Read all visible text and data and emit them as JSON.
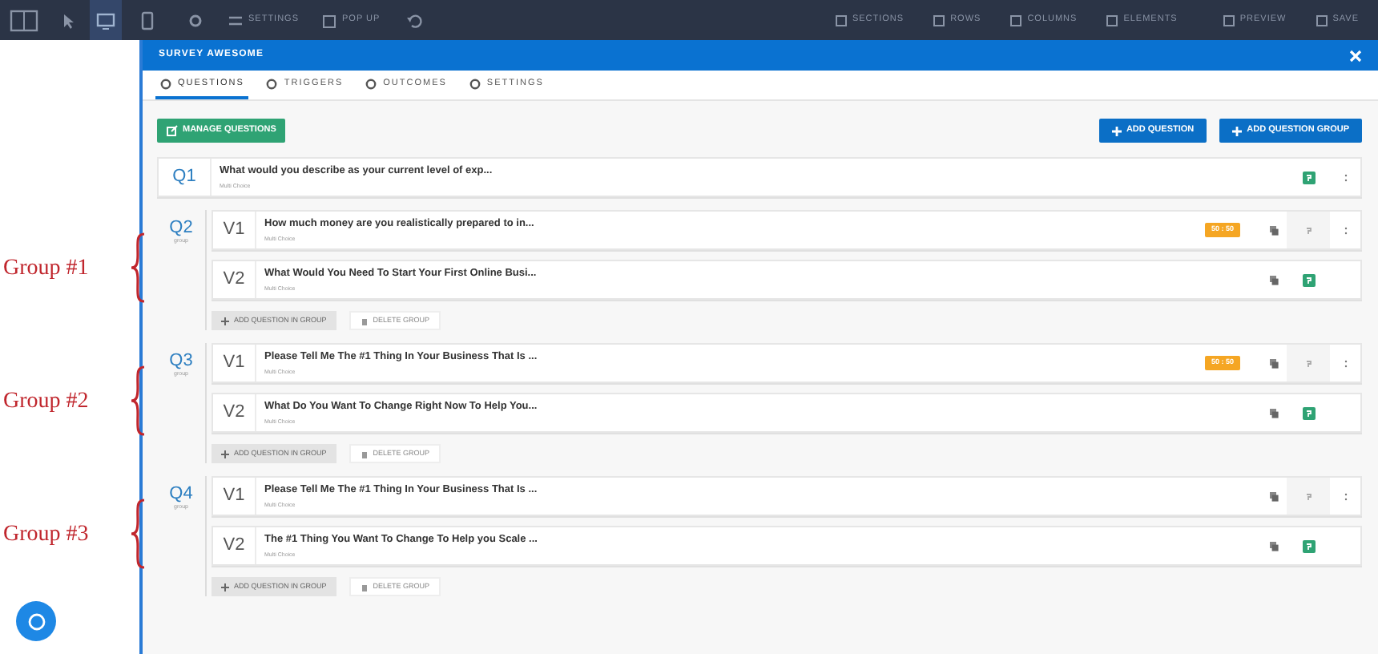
{
  "toolbar": {
    "devices": [
      {
        "selected": true
      },
      {
        "selected": false
      }
    ],
    "left_items": [
      "SETTINGS",
      "POP UP"
    ],
    "right_items": [
      "SECTIONS",
      "ROWS",
      "COLUMNS",
      "ELEMENTS",
      "PREVIEW",
      "SAVE"
    ]
  },
  "modal": {
    "title": "SURVEY AWESOME",
    "tabs": [
      {
        "label": "QUESTIONS",
        "selected": true
      },
      {
        "label": "TRIGGERS",
        "selected": false
      },
      {
        "label": "OUTCOMES",
        "selected": false
      },
      {
        "label": "SETTINGS",
        "selected": false
      }
    ],
    "manage_button": "MANAGE QUESTIONS",
    "add_question_button": "ADD QUESTION",
    "add_group_button": "ADD QUESTION GROUP",
    "questions": [
      {
        "kind": "question",
        "number": "Q1",
        "title": "What would you describe as your current level of exp...",
        "subtitle": "Multi Choice",
        "logic_active": true,
        "menu": true
      },
      {
        "kind": "group",
        "number": "Q2",
        "label": "group",
        "annotation": "Group #1",
        "add_button": "ADD QUESTION IN GROUP",
        "delete_button": "DELETE GROUP",
        "variants": [
          {
            "number": "V1",
            "title": "How much money are you realistically prepared to in...",
            "subtitle": "Multi Choice",
            "badge": "50 : 50",
            "logic_active": false,
            "menu": true
          },
          {
            "number": "V2",
            "title": "What Would You Need To Start Your First Online Busi...",
            "subtitle": "Multi Choice",
            "logic_active": true,
            "menu": false
          }
        ]
      },
      {
        "kind": "group",
        "number": "Q3",
        "label": "group",
        "annotation": "Group #2",
        "add_button": "ADD QUESTION IN GROUP",
        "delete_button": "DELETE GROUP",
        "variants": [
          {
            "number": "V1",
            "title": "Please Tell Me The #1 Thing In Your Business That Is ...",
            "subtitle": "Multi Choice",
            "badge": "50 : 50",
            "logic_active": false,
            "menu": true
          },
          {
            "number": "V2",
            "title": "What Do You Want To Change Right Now To Help You...",
            "subtitle": "Multi Choice",
            "logic_active": true,
            "menu": false
          }
        ]
      },
      {
        "kind": "group",
        "number": "Q4",
        "label": "group",
        "annotation": "Group #3",
        "add_button": "ADD QUESTION IN GROUP",
        "delete_button": "DELETE GROUP",
        "variants": [
          {
            "number": "V1",
            "title": "Please Tell Me The #1 Thing In Your Business That Is ...",
            "subtitle": "Multi Choice",
            "logic_active": false,
            "menu": true
          },
          {
            "number": "V2",
            "title": "The #1 Thing You Want To Change To Help you Scale ...",
            "subtitle": "Multi Choice",
            "logic_active": true,
            "menu": false
          }
        ]
      }
    ]
  }
}
